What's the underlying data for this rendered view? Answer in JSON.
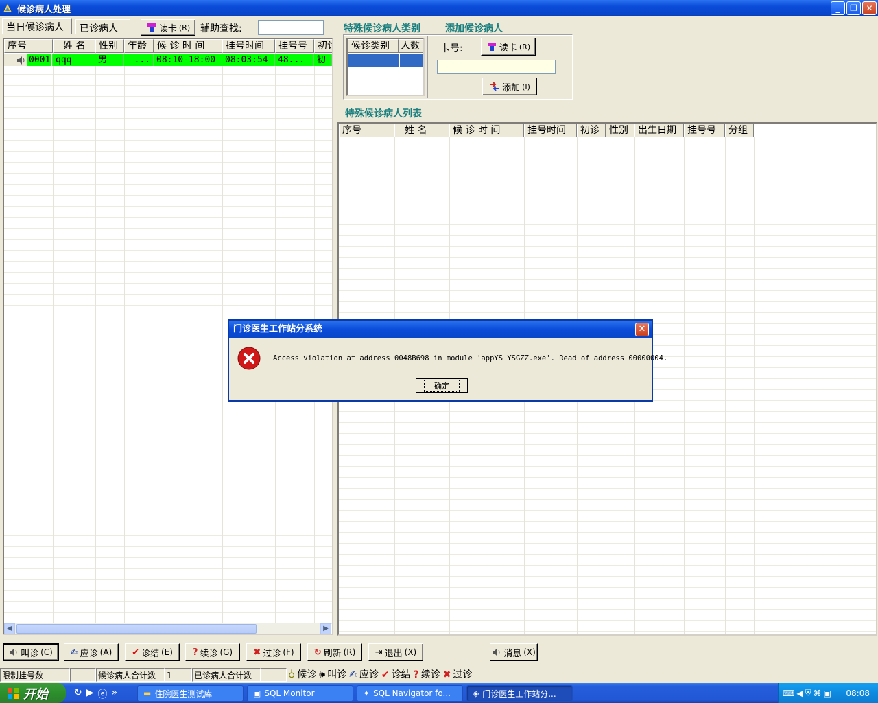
{
  "window": {
    "title": "候诊病人处理"
  },
  "tabs": [
    {
      "label": "当日候诊病人"
    },
    {
      "label": "已诊病人"
    }
  ],
  "toolbar": {
    "read_card_label": "读卡",
    "read_card_key": "(R)",
    "assist_search_label": "辅助查找:",
    "assist_search_value": ""
  },
  "waiting_table": {
    "columns": [
      "序号",
      "姓 名",
      "性别",
      "年龄",
      "候 诊 时 间",
      "挂号时间",
      "挂号号",
      "初诊"
    ],
    "rows": [
      {
        "seq": "0001",
        "name": "qqq",
        "sex": "男",
        "age": "...",
        "wait_time": "08:10-18:00",
        "reg_time": "08:03:54",
        "reg_no": "48...",
        "first": "初"
      }
    ]
  },
  "special_category": {
    "title": "特殊候诊病人类别",
    "columns": [
      "候诊类别",
      "人数"
    ]
  },
  "add_patient": {
    "title": "添加候诊病人",
    "card_label": "卡号:",
    "card_value": "",
    "read_card_label": "读卡",
    "read_card_key": "(R)",
    "add_label": "添加",
    "add_key": "(I)"
  },
  "special_list": {
    "title": "特殊候诊病人列表",
    "columns": [
      "序号",
      "姓 名",
      "候 诊 时 间",
      "挂号时间",
      "初诊",
      "性别",
      "出生日期",
      "挂号号",
      "分组"
    ]
  },
  "actions": [
    {
      "label": "叫诊",
      "key": "(C)"
    },
    {
      "label": "应诊",
      "key": "(A)"
    },
    {
      "label": "诊结",
      "key": "(E)"
    },
    {
      "label": "续诊",
      "key": "(G)"
    },
    {
      "label": "过诊",
      "key": "(F)"
    },
    {
      "label": "刷新",
      "key": "(R)"
    },
    {
      "label": "退出",
      "key": "(X)"
    },
    {
      "label": "消息",
      "key": "(X)"
    }
  ],
  "status": {
    "limit_label": "限制挂号数",
    "limit_value": "",
    "waiting_total_label": "候诊病人合计数",
    "waiting_total_value": "1",
    "seen_total_label": "已诊病人合计数",
    "seen_total_value": ""
  },
  "legend": [
    {
      "label": "候诊"
    },
    {
      "label": "叫诊"
    },
    {
      "label": "应诊"
    },
    {
      "label": "诊结"
    },
    {
      "label": "续诊"
    },
    {
      "label": "过诊"
    }
  ],
  "dialog": {
    "title": "门诊医生工作站分系统",
    "message": "Access violation at address 0048B698 in module 'appYS_YSGZZ.exe'. Read of address 00000004.",
    "ok_label": "确定"
  },
  "taskbar": {
    "start_label": "开始",
    "tasks": [
      {
        "label": "住院医生测试库"
      },
      {
        "label": "SQL Monitor"
      },
      {
        "label": "SQL Navigator fo..."
      },
      {
        "label": "门诊医生工作站分..."
      }
    ],
    "clock": "08:08"
  },
  "colors": {
    "selected_row": "#00ff00",
    "section_title": "#1a7f7f",
    "titlebar": "#0a4bd8"
  }
}
